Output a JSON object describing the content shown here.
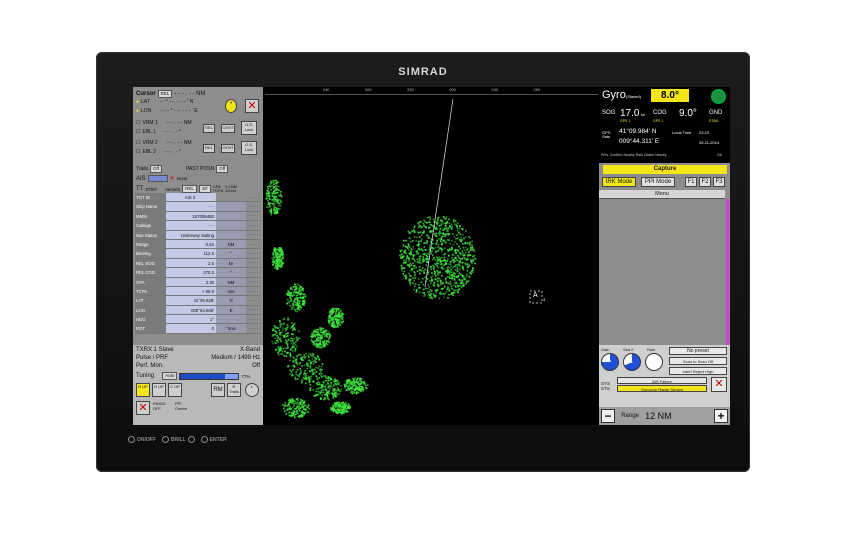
{
  "brand": "SIMRAD",
  "bezel_buttons": [
    "ON/OFF",
    "BRILL",
    "ENTER"
  ],
  "left": {
    "cursor_label": "Cursor",
    "rel": "REL",
    "cursor_val": "- - - . - - NM",
    "lat_label": "LAT",
    "lon_label": "LON",
    "lat_val": "- - ° - - . - - - ' N",
    "lon_val": "- - - ° - - . - - - ' E",
    "vrm1": "VRM 1",
    "ebl1": "EBL 1",
    "vrm2": "VRM 2",
    "ebl2": "EBL 2",
    "vrm_val": "- - - . - - NM",
    "ebl_val": "- - - . - °",
    "cent": "CENT",
    "os_lock": "O.S. Lock",
    "trails": "Trails",
    "trails_off": "Off",
    "past_posn": "PAST POSN",
    "past_off": "Off",
    "ais": "AIS",
    "none": "None",
    "tt": "TT",
    "stby": "STBY",
    "vectors": "Vectors",
    "vector_rel": "REL",
    "vector_min": "10'",
    "cpa": "CPA",
    "tcpa": "TCPA",
    "cpa_val": "0.1NM",
    "tcpa_val": "10min",
    "tgt_id_label": "TGT ID",
    "tgt_id_val": "AIS 3",
    "table": [
      {
        "k": "Ship Name",
        "v": "- - -",
        "u": ""
      },
      {
        "k": "MMSI",
        "v": "247099460",
        "u": ""
      },
      {
        "k": "Callsign",
        "v": "- - -",
        "u": ""
      },
      {
        "k": "Nav Status",
        "v": "Underway Sailing",
        "u": ""
      },
      {
        "k": "Range",
        "v": "0.64",
        "u": "NM"
      },
      {
        "k": "Bearing",
        "v": "112.6",
        "u": "°"
      },
      {
        "k": "REL SOG",
        "v": "2.5",
        "u": "kn"
      },
      {
        "k": "REL COG",
        "v": "270.3",
        "u": "°"
      },
      {
        "k": "CPA",
        "v": "3.30",
        "u": "NM"
      },
      {
        "k": "TCPA",
        "v": "+ 99.9",
        "u": "min"
      },
      {
        "k": "LAT",
        "v": "41°05.628'",
        "u": "N"
      },
      {
        "k": "LON",
        "v": "009°54.668'",
        "u": "E"
      },
      {
        "k": "HDG",
        "v": "1°",
        "u": ""
      },
      {
        "k": "ROT",
        "v": "0",
        "u": "°/min"
      }
    ],
    "dashes": "- - - -",
    "txrx": "TXRX 1 Slave",
    "band": "X-Band",
    "pulse": "Pulse / PRF",
    "pulse_val": "Medium / 1499 Hz",
    "perf": "Perf. Mon.",
    "perf_val": "Off",
    "tuning": "Tuning",
    "auto": "Auto",
    "tuning_pct": "77%",
    "tuning_level": 77,
    "n_up": "N UP",
    "h_up": "H UP",
    "c_up": "C UP",
    "rm": "RM",
    "r_trails": "R Trails",
    "rings": "RINGS",
    "rings_off": "OFF",
    "ppi": "PPI",
    "centre": "Centre"
  },
  "radar": {
    "scale": [
      "240",
      "300",
      "330",
      "000",
      "030",
      "060"
    ],
    "target_label": "A",
    "target_num": "3"
  },
  "right": {
    "gyro": "Gyro",
    "gyro_sub": "(Slaved)",
    "heading": "8.0°",
    "sog": "SOG",
    "sog_val": "17.0",
    "sog_unit": "kn",
    "cog": "COG",
    "cog_val": "9.0°",
    "gnd": "GND",
    "stab": "STAB",
    "gps_src": "GPS 1",
    "gps_sats": "GPS Sats",
    "lat": "41°09.984' N",
    "lon": "009°44.311' E",
    "local_time_label": "Local Time",
    "local_time": "22:23",
    "date": "26-11-2014",
    "status": "Prev. Conflict: Nearby Rain Clutter Nearby",
    "status_num": "2/6",
    "capture": "Capture",
    "irk_mode": "IRK Mode",
    "ppi_mode": "PPI Mode",
    "f1": "F1",
    "f2": "F2",
    "f3": "F3",
    "menu": "Menu",
    "gain": "Gain",
    "sea": "Sea 2",
    "rain": "Rain",
    "gain_val": "A",
    "sea_val": "68",
    "no_preset": "No preset",
    "scan": "Scan to Scan Off",
    "interf": "Interf Reject High",
    "sys": "SYS STS",
    "ais_failure": "AIS Failure",
    "gyro_failure": "Gyrocmp Radar Sensor",
    "range_label": "Range",
    "range_val": "12 NM",
    "minus": "−",
    "plus": "+"
  },
  "colors": {
    "accent_yellow": "#f3e616",
    "radar_green": "#3ee83e",
    "panel_gray": "#8d8d8d"
  }
}
